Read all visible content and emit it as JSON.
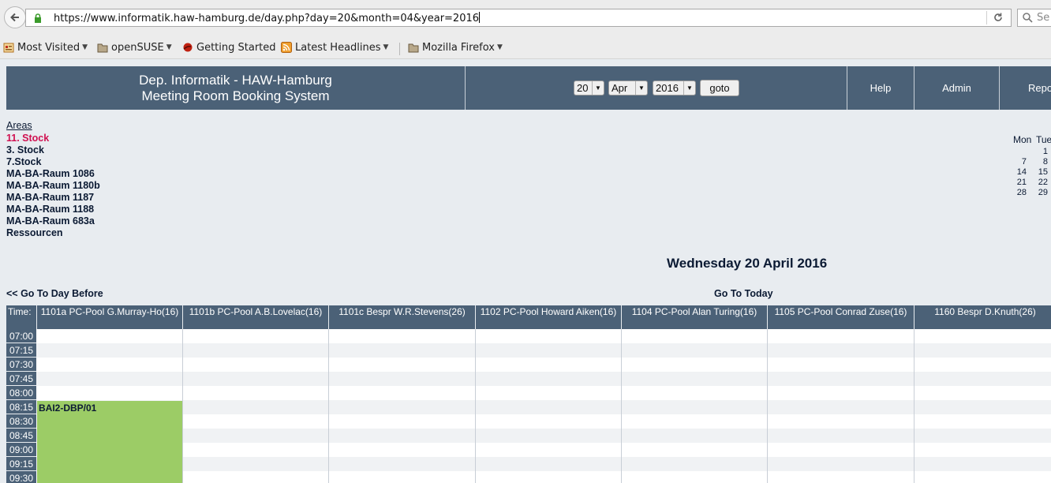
{
  "browser": {
    "url": "https://www.informatik.haw-hamburg.de/day.php?day=20&month=04&year=2016",
    "search_placeholder": "Se",
    "bookmarks": [
      {
        "label": "Most Visited",
        "icon": "most-visited-icon"
      },
      {
        "label": "openSUSE",
        "icon": "folder-icon"
      },
      {
        "label": "Getting Started",
        "icon": "firefox-icon"
      },
      {
        "label": "Latest Headlines",
        "icon": "rss-icon"
      },
      {
        "label": "Mozilla Firefox",
        "icon": "folder-icon"
      }
    ]
  },
  "header": {
    "title_line1": "Dep. Informatik - HAW-Hamburg",
    "title_line2": "Meeting Room Booking System",
    "day": "20",
    "month": "Apr",
    "year": "2016",
    "goto": "goto",
    "help": "Help",
    "admin": "Admin",
    "report": "Repo"
  },
  "areas": {
    "heading": "Areas",
    "items": [
      "11. Stock",
      "3. Stock",
      "7.Stock",
      "MA-BA-Raum 1086",
      "MA-BA-Raum 1180b",
      "MA-BA-Raum 1187",
      "MA-BA-Raum 1188",
      "MA-BA-Raum 683a",
      "Ressourcen"
    ],
    "current_index": 0
  },
  "calendar": {
    "weekdays": [
      "Mon",
      "Tue"
    ],
    "rows": [
      [
        "",
        "1"
      ],
      [
        "7",
        "8"
      ],
      [
        "14",
        "15"
      ],
      [
        "21",
        "22"
      ],
      [
        "28",
        "29"
      ]
    ]
  },
  "day": {
    "title": "Wednesday 20 April 2016",
    "prev": "<< Go To Day Before",
    "today": "Go To Today"
  },
  "grid": {
    "time_label": "Time:",
    "rooms": [
      "1101a PC-Pool G.Murray-Ho(16)",
      "1101b PC-Pool A.B.Lovelac(16)",
      "1101c Bespr W.R.Stevens(26)",
      "1102 PC-Pool Howard Aiken(16)",
      "1104 PC-Pool Alan Turing(16)",
      "1105 PC-Pool Conrad Zuse(16)",
      "1160 Bespr D.Knuth(26)"
    ],
    "times": [
      "07:00",
      "07:15",
      "07:30",
      "07:45",
      "08:00",
      "08:15",
      "08:30",
      "08:45",
      "09:00",
      "09:15",
      "09:30"
    ],
    "booking": {
      "label": "BAI2-DBP/01",
      "room_index": 0,
      "start": "08:15",
      "color": "#9ccc66"
    }
  },
  "colors": {
    "header_bg": "#4b6177",
    "current_area": "#d01050",
    "page_bg": "#e8ecf0"
  }
}
